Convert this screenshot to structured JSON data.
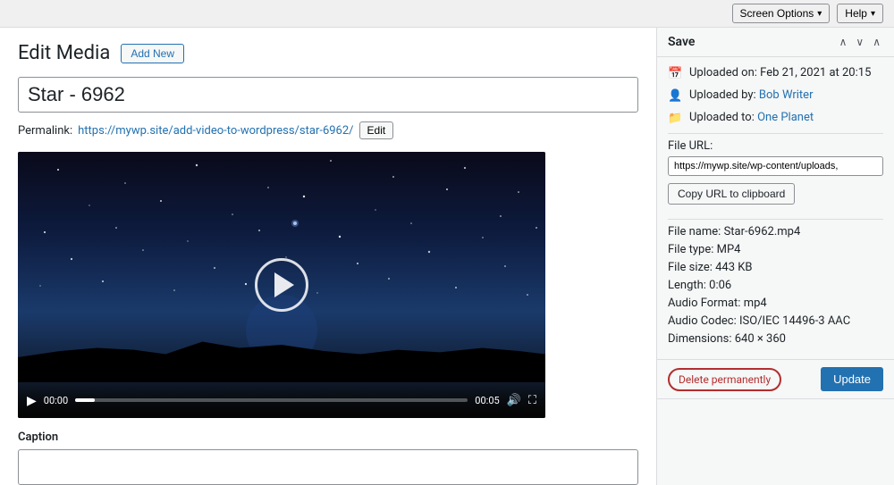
{
  "topbar": {
    "screen_options_label": "Screen Options",
    "help_label": "Help"
  },
  "header": {
    "title": "Edit Media",
    "add_new_label": "Add New"
  },
  "media": {
    "title": "Star - 6962",
    "permalink_label": "Permalink:",
    "permalink_url": "https://mywp.site/add-video-to-wordpress/star-6962/",
    "permalink_edit_label": "Edit",
    "video_time_current": "00:00",
    "video_time_total": "00:05"
  },
  "caption": {
    "label": "Caption",
    "placeholder": ""
  },
  "sidebar": {
    "save_title": "Save",
    "uploaded_on_label": "Uploaded on:",
    "uploaded_on_value": "Feb 21, 2021 at 20:15",
    "uploaded_by_label": "Uploaded by:",
    "uploaded_by_value": "Bob Writer",
    "uploaded_to_label": "Uploaded to:",
    "uploaded_to_value": "One Planet",
    "file_url_label": "File URL:",
    "file_url_value": "https://mywp.site/wp-content/uploads,",
    "copy_url_label": "Copy URL to clipboard",
    "file_name_label": "File name:",
    "file_name_value": "Star-6962.mp4",
    "file_type_label": "File type:",
    "file_type_value": "MP4",
    "file_size_label": "File size:",
    "file_size_value": "443 KB",
    "length_label": "Length:",
    "length_value": "0:06",
    "audio_format_label": "Audio Format:",
    "audio_format_value": "mp4",
    "audio_codec_label": "Audio Codec:",
    "audio_codec_value": "ISO/IEC 14496-3 AAC",
    "dimensions_label": "Dimensions:",
    "dimensions_value": "640 × 360",
    "delete_label": "Delete permanently",
    "update_label": "Update"
  }
}
